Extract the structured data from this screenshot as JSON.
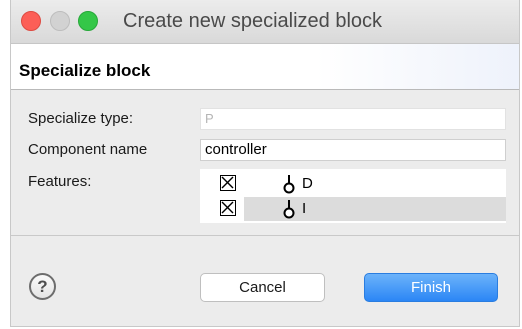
{
  "window": {
    "title": "Create new specialized block"
  },
  "header": {
    "title": "Specialize block"
  },
  "form": {
    "specialize_type_label": "Specialize type:",
    "specialize_type_value": "P",
    "component_name_label": "Component name",
    "component_name_value": "controller",
    "features_label": "Features:"
  },
  "features": [
    {
      "name": "D",
      "checked": true
    },
    {
      "name": "I",
      "checked": true
    }
  ],
  "buttons": {
    "help_label": "?",
    "cancel_label": "Cancel",
    "finish_label": "Finish"
  },
  "colors": {
    "close": "#fc5f57",
    "minimize": "#d2d2d2",
    "zoom": "#34c748",
    "finish_button": "#2b86f5"
  }
}
